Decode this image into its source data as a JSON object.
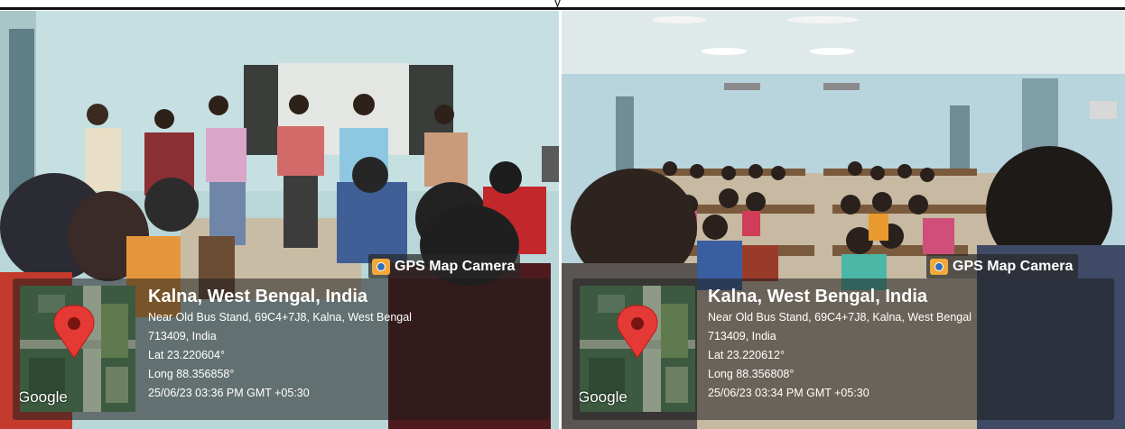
{
  "header": {
    "glyph": "y"
  },
  "photos": [
    {
      "badge": "GPS Map Camera",
      "map_logo": "Google",
      "place": "Kalna, West Bengal, India",
      "address_line1": "Near Old Bus Stand, 69C4+7J8, Kalna, West Bengal",
      "address_line2": "713409, India",
      "lat": "Lat 23.220604°",
      "long": "Long 88.356858°",
      "datetime": "25/06/23 03:36 PM GMT +05:30"
    },
    {
      "badge": "GPS Map Camera",
      "map_logo": "Google",
      "place": "Kalna, West Bengal, India",
      "address_line1": "Near Old Bus Stand, 69C4+7J8, Kalna, West Bengal",
      "address_line2": "713409, India",
      "lat": "Lat 23.220612°",
      "long": "Long 88.356808°",
      "datetime": "25/06/23 03:34 PM GMT +05:30"
    }
  ],
  "colors": {
    "pin": "#e53935",
    "badge_icon": "#f2a83a"
  }
}
